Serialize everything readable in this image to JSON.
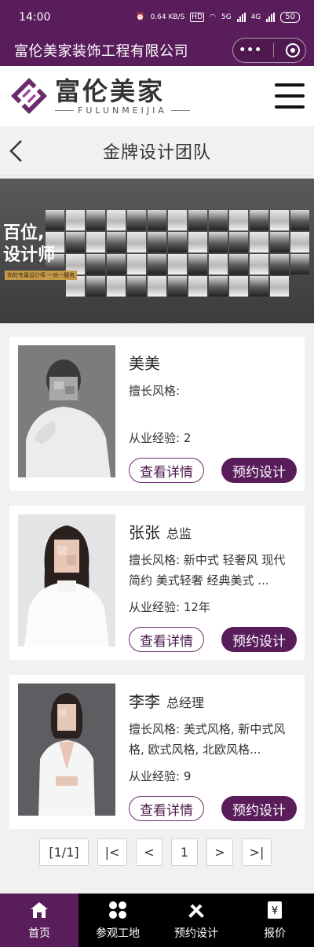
{
  "status_bar": {
    "time": "14:00",
    "speed": "0.64 KB/S",
    "hd": "HD",
    "net1": "5G",
    "net2": "4G",
    "battery": "50"
  },
  "mini_program": {
    "title": "富伦美家装饰工程有限公司",
    "more_icon": "ellipsis-icon",
    "close_icon": "target-icon"
  },
  "brand": {
    "name_cn": "富伦美家",
    "name_en": "FULUNMEIJIA"
  },
  "page": {
    "title": "金牌设计团队"
  },
  "banner": {
    "headline_1": "百位,",
    "headline_2": "设计师",
    "subline": "你的专属设计师  一对一服务"
  },
  "designers": [
    {
      "name": "美美",
      "title": "",
      "style_label": "擅长风格:",
      "style_value": "",
      "exp_label": "从业经验:",
      "exp_value": "2",
      "detail_label": "查看详情",
      "book_label": "预约设计"
    },
    {
      "name": "张张",
      "title": "总监",
      "style_label": "擅长风格:",
      "style_value": "新中式 轻奢风 现代简约 美式轻奢 经典美式 ...",
      "exp_label": "从业经验:",
      "exp_value": "12年",
      "detail_label": "查看详情",
      "book_label": "预约设计"
    },
    {
      "name": "李李",
      "title": "总经理",
      "style_label": "擅长风格:",
      "style_value": "美式风格, 新中式风格, 欧式风格, 北欧风格...",
      "exp_label": "从业经验:",
      "exp_value": "9",
      "detail_label": "查看详情",
      "book_label": "预约设计"
    }
  ],
  "pagination": {
    "info": "[1/1]",
    "first": "|<",
    "prev": "<",
    "current": "1",
    "next": ">",
    "last": ">|"
  },
  "tabbar": [
    {
      "label": "首页",
      "icon": "home-icon",
      "active": true
    },
    {
      "label": "参观工地",
      "icon": "grid-icon",
      "active": false
    },
    {
      "label": "预约设计",
      "icon": "tools-icon",
      "active": false
    },
    {
      "label": "报价",
      "icon": "quote-icon",
      "active": false
    }
  ],
  "colors": {
    "brand_purple": "#5a1d5c",
    "tab_bg": "#000000",
    "page_bg": "#f1f1f1"
  }
}
